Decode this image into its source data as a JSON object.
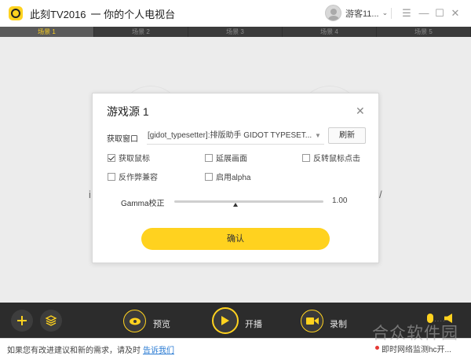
{
  "app": {
    "title": "此刻TV2016",
    "slogan": "一 你的个人电视台"
  },
  "user": {
    "name": "游客11..."
  },
  "window_controls": {
    "menu": "☰",
    "minimize": "—",
    "maximize": "☐",
    "close": "✕"
  },
  "scenes": {
    "tabs": [
      "场景 1",
      "场景 2",
      "场景 3",
      "场景 4",
      "场景 5"
    ],
    "active_index": 0
  },
  "preview": {
    "left_text": "i",
    "right_text": "/"
  },
  "dialog": {
    "title": "游戏源 1",
    "capture_window_label": "获取窗口",
    "capture_window_value": "[gidot_typesetter]:排版助手 GIDOT TYPESET...",
    "refresh_label": "刷新",
    "options": [
      {
        "label": "获取鼠标",
        "checked": true
      },
      {
        "label": "延展画面",
        "checked": false
      },
      {
        "label": "反转鼠标点击",
        "checked": false
      },
      {
        "label": "反作弊兼容",
        "checked": false
      },
      {
        "label": "启用alpha",
        "checked": false
      }
    ],
    "gamma_label": "Gamma校正",
    "gamma_value": "1.00",
    "gamma_fraction": 0.41,
    "confirm_label": "确认"
  },
  "toolbar": {
    "preview_label": "预览",
    "start_label": "开播",
    "record_label": "录制"
  },
  "status": {
    "message": "如果您有改进建议和新的需求，请及时",
    "link": "告诉我们",
    "recording": "即时网络监测hc开..."
  },
  "watermark": "合众软件园",
  "colors": {
    "accent": "#ffd21f",
    "toolbar_bg": "#2c2c2c",
    "tab_bg": "#3b3b3b",
    "link": "#2a7bd3"
  }
}
